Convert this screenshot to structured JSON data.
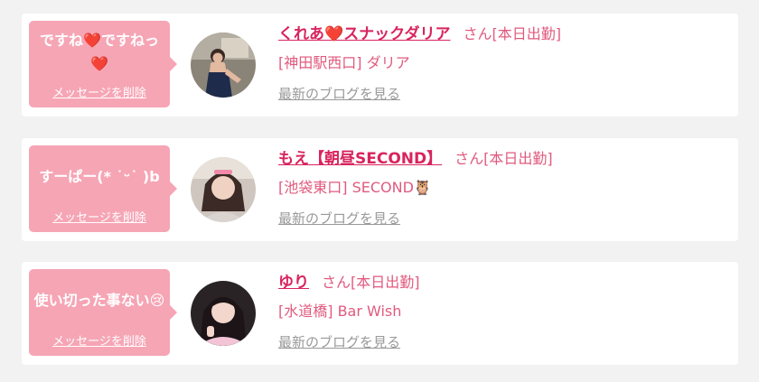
{
  "colors": {
    "background": "#f2f2f2",
    "card": "#ffffff",
    "bubble": "#f6a5b5",
    "name": "#d8245e",
    "store": "#e05a7e",
    "blog_link": "#999999"
  },
  "cards": [
    {
      "message": "ですね❤️ですねっ❤️",
      "delete_label": "メッセージを削除",
      "name": "くれあ❤️スナックダリア",
      "status": "さん[本日出勤]",
      "store": "[神田駅西口] ダリア",
      "blog_label": "最新のブログを見る",
      "avatar_icon": "woman-photo-avatar"
    },
    {
      "message": "すーぱー(* ˙ᵕ˙ )b",
      "delete_label": "メッセージを削除",
      "name": "もえ【朝昼SECOND】",
      "status": "さん[本日出勤]",
      "store": "[池袋東口] SECOND🦉",
      "blog_label": "最新のブログを見る",
      "avatar_icon": "woman-photo-avatar"
    },
    {
      "message": "使い切った事ない😢",
      "delete_label": "メッセージを削除",
      "name": "ゆり",
      "status": "さん[本日出勤]",
      "store": "[水道橋] Bar Wish",
      "blog_label": "最新のブログを見る",
      "avatar_icon": "woman-photo-avatar"
    }
  ]
}
